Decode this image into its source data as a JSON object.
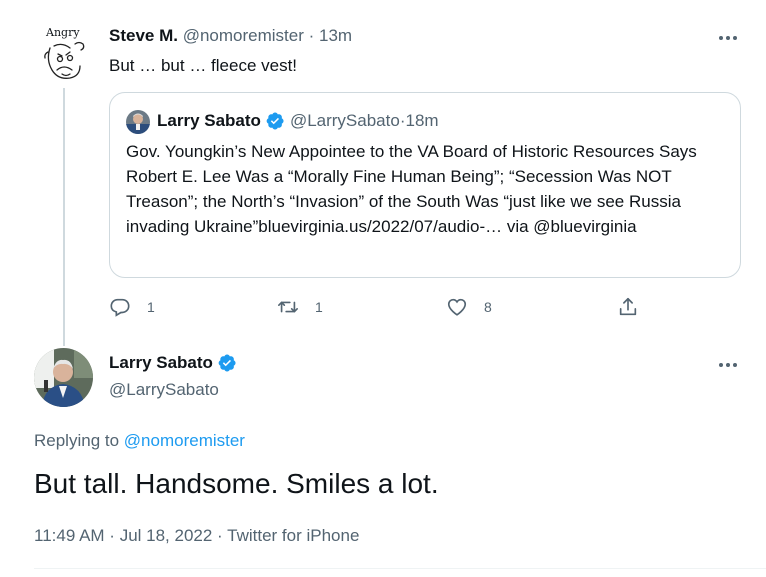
{
  "parent": {
    "name": "Steve M.",
    "handle": "@nomoremister",
    "time": "13m",
    "avatar_label": "Angry",
    "text": "But … but … fleece vest!"
  },
  "quote": {
    "name": "Larry Sabato",
    "handle": "@LarrySabato",
    "time": "18m",
    "text": "Gov. Youngkin’s New Appointee to the VA Board of Historic Resources Says Robert E. Lee Was a “Morally Fine Human Being”; “Secession Was NOT Treason”;  the North’s “Invasion” of the South Was “just like we see Russia invading Ukraine”bluevirginia.us/2022/07/audio-… via @bluevirginia"
  },
  "actions": {
    "reply_count": "1",
    "retweet_count": "1",
    "like_count": "8"
  },
  "main": {
    "name": "Larry Sabato",
    "handle": "@LarrySabato",
    "replying_label": "Replying to",
    "replying_to": "@nomoremister",
    "text": "But tall. Handsome. Smiles a lot.",
    "time": "11:49 AM",
    "date": "Jul 18, 2022",
    "source": "Twitter for iPhone"
  },
  "separator": " · ",
  "colors": {
    "accent": "#1d9bf0",
    "text": "#0f1419",
    "secondary": "#536471",
    "border": "#cfd9de"
  },
  "icons": {
    "verified": "verified-badge-icon",
    "reply": "reply-icon",
    "retweet": "retweet-icon",
    "like": "heart-icon",
    "share": "share-icon",
    "more": "more-icon"
  }
}
